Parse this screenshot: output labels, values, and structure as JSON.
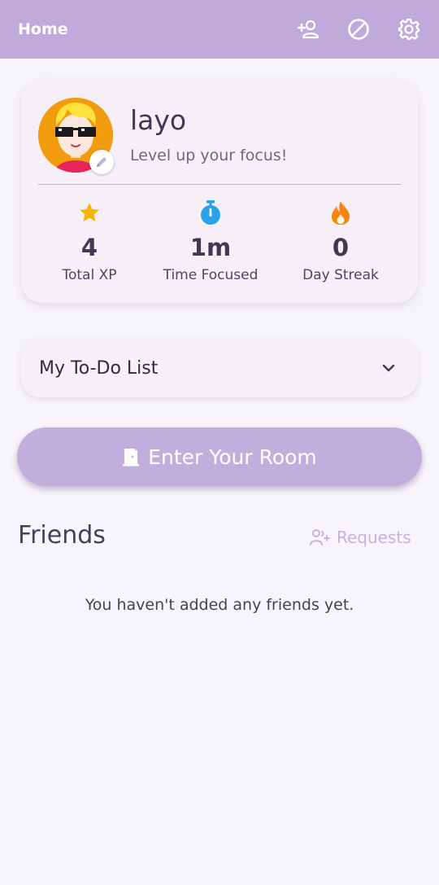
{
  "appbar": {
    "title": "Home",
    "actions": [
      {
        "icon": "add-friend-icon"
      },
      {
        "icon": "block-icon"
      },
      {
        "icon": "settings-icon"
      }
    ]
  },
  "profile": {
    "username": "layo",
    "tagline": "Level up your focus!",
    "avatar_icon": "avatar-face-sunglasses",
    "stats": [
      {
        "icon": "star-icon",
        "value": "4",
        "label": "Total XP",
        "color": "#f4b400"
      },
      {
        "icon": "stopwatch-icon",
        "value": "1m",
        "label": "Time Focused",
        "color": "#29a3e6"
      },
      {
        "icon": "flame-icon",
        "value": "0",
        "label": "Day Streak",
        "color": "#f5860f"
      }
    ]
  },
  "todo": {
    "label": "My To-Do List",
    "icon": "chevron-down-icon"
  },
  "enter_room": {
    "label": "Enter Your Room",
    "icon": "door-icon"
  },
  "friends": {
    "title": "Friends",
    "requests_label": "Requests",
    "empty_message": "You haven't added any friends yet."
  },
  "colors": {
    "appbar": "#bfaadb",
    "card": "#f6eff7",
    "primary_button": "#c2aedd",
    "background": "#f7f4fb"
  }
}
